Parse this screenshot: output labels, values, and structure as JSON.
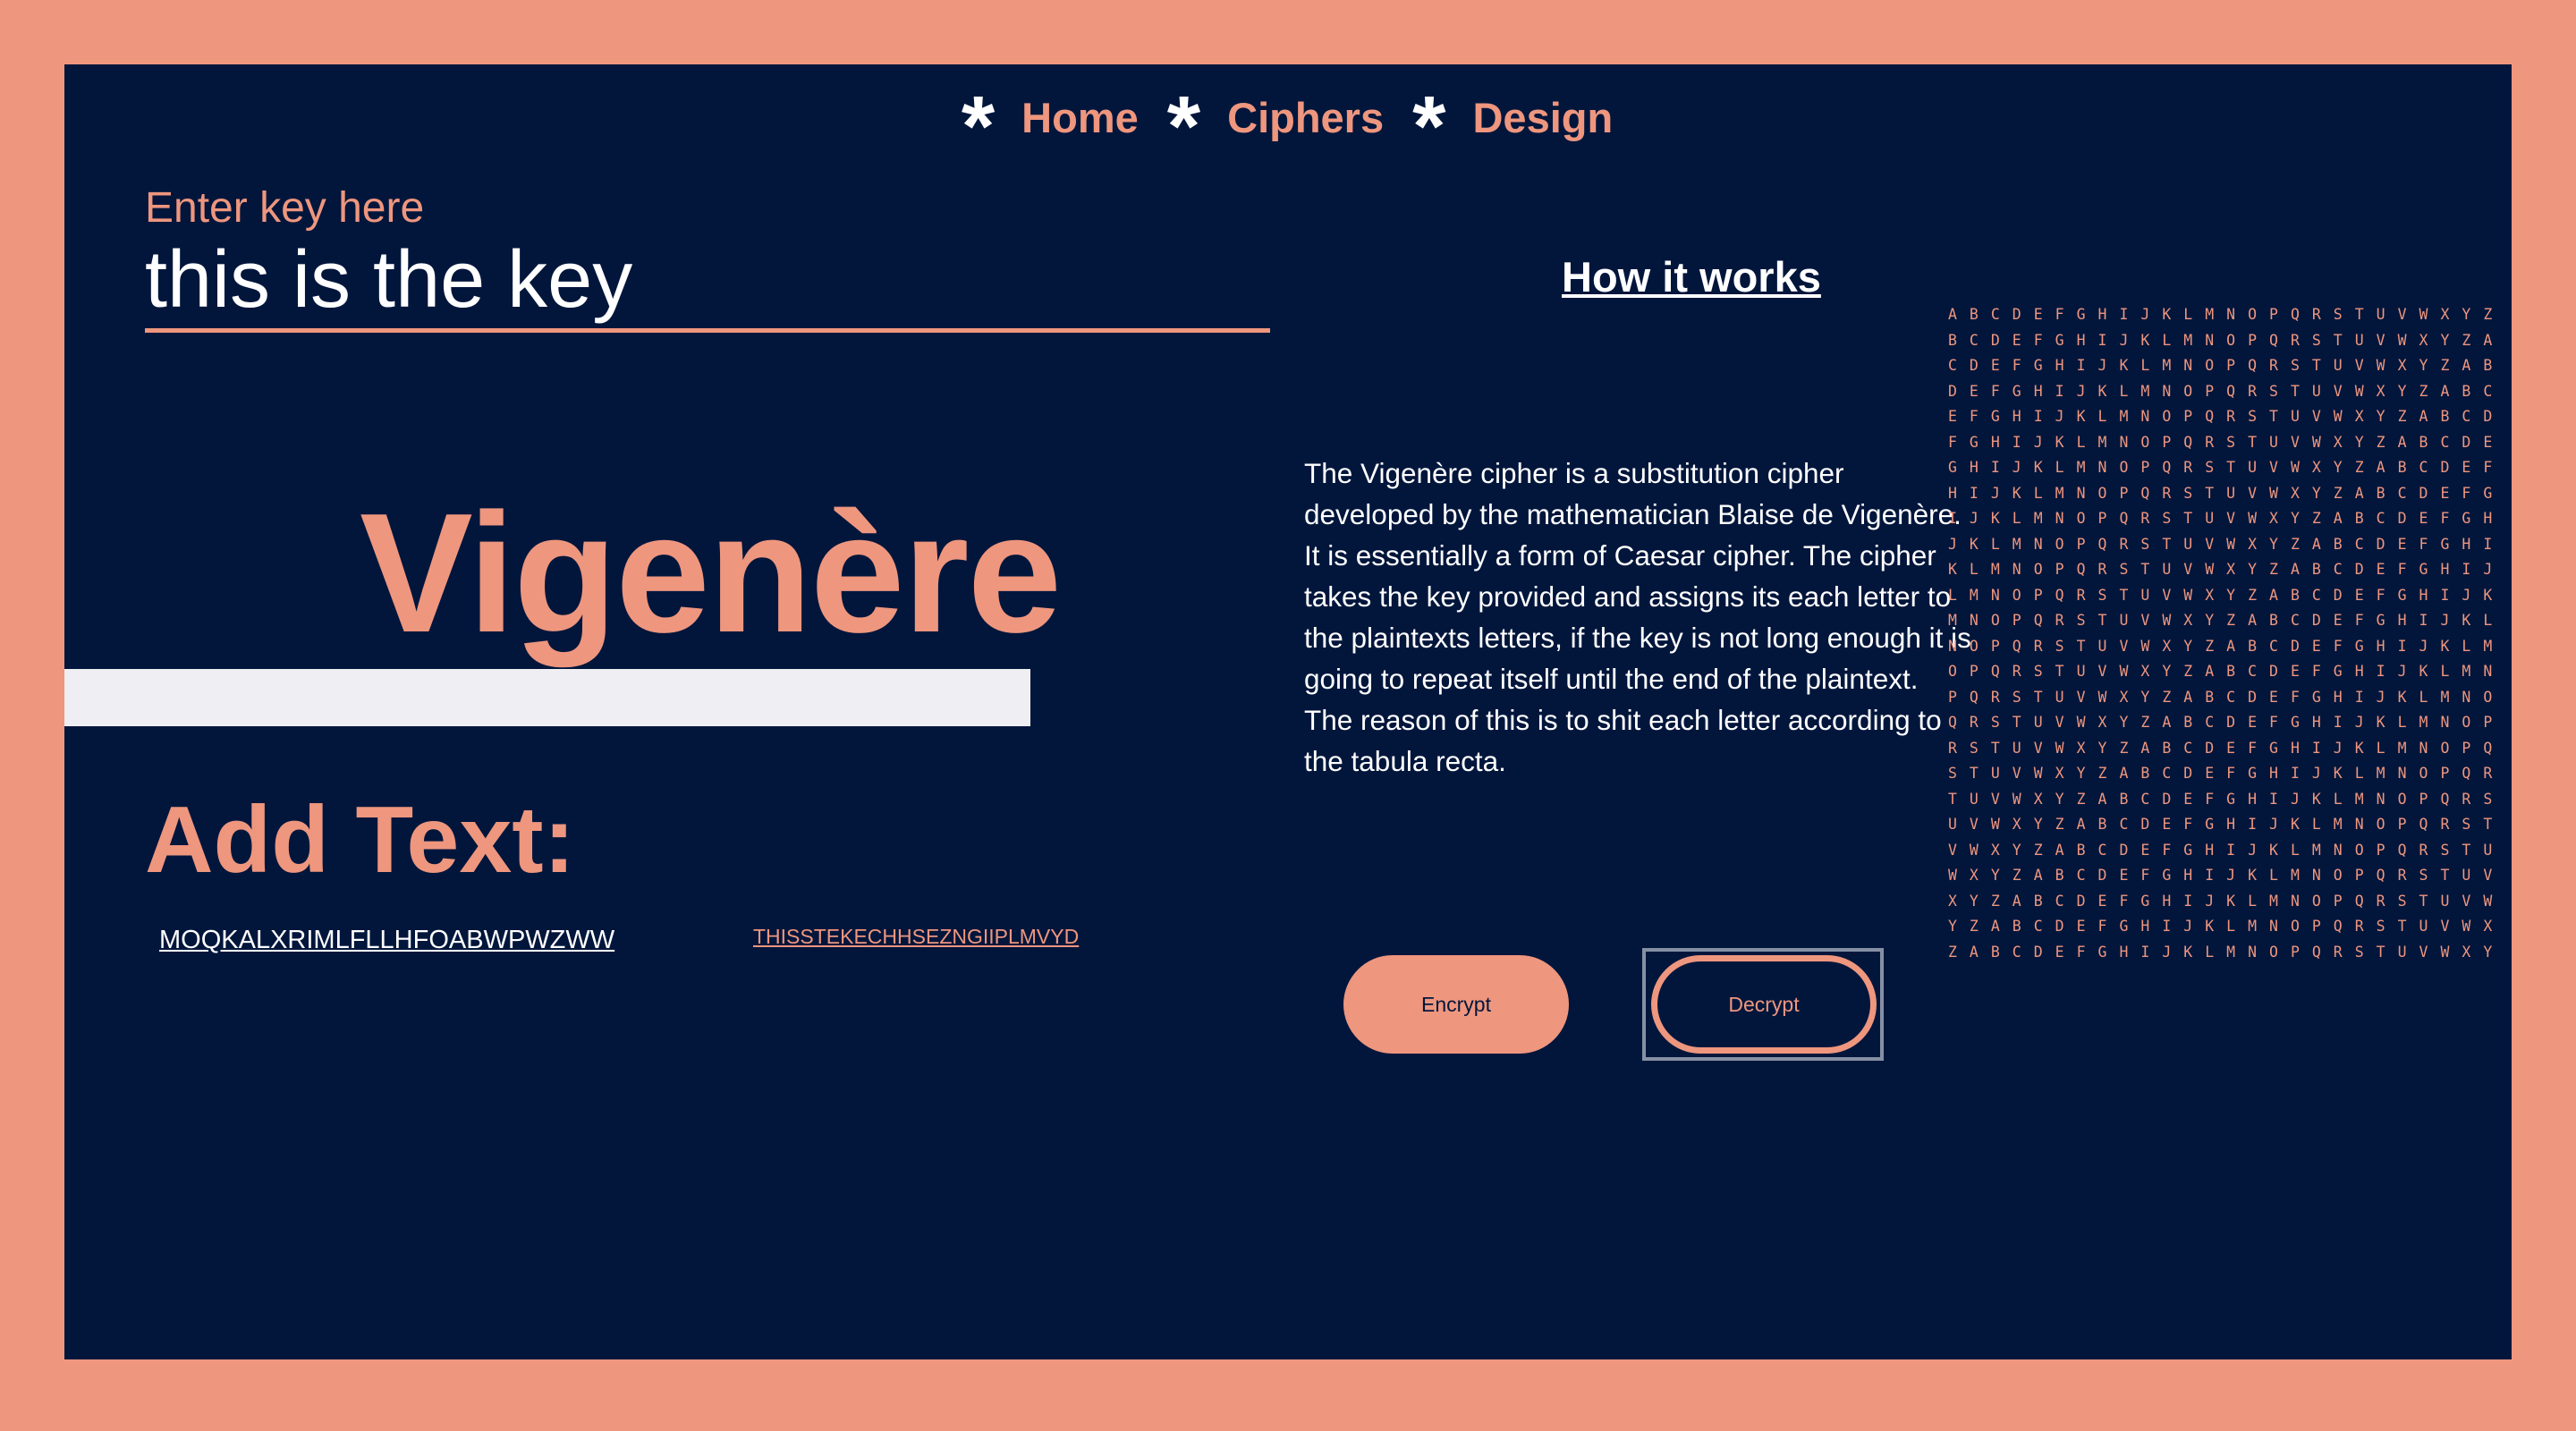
{
  "nav": {
    "items": [
      {
        "star": "*",
        "label": "Home"
      },
      {
        "star": "*",
        "label": "Ciphers"
      },
      {
        "star": "*",
        "label": "Design"
      }
    ]
  },
  "key": {
    "label": "Enter key here",
    "value": "this is the key"
  },
  "cipher": {
    "title": "Vigenère",
    "add_text_label": "Add Text:",
    "ciphertext": "MOQKALXRIMLFLLHFOABWPWZWW",
    "plaintext": "THISSTEKECHHSEZNGIIPLMVYD"
  },
  "info": {
    "heading": "How it works",
    "description": "The Vigenère cipher is a substitution cipher developed by the mathematician Blaise de Vigenère. It is essentially a form of Caesar cipher. The cipher takes the key provided and assigns its each letter to the plaintexts letters, if the key is not long enough it is going to repeat itself until the end of the plaintext. The reason of this is to shit each letter according to the tabula recta."
  },
  "buttons": {
    "encrypt": "Encrypt",
    "decrypt": "Decrypt"
  },
  "tabula_recta": {
    "alphabet": "ABCDEFGHIJKLMNOPQRSTUVWXYZ",
    "rows_visible": 26
  },
  "colors": {
    "background": "#ee967e",
    "panel": "#02163c",
    "accent": "#ee967e",
    "stripe": "#efeef3",
    "text": "#ffffff"
  }
}
